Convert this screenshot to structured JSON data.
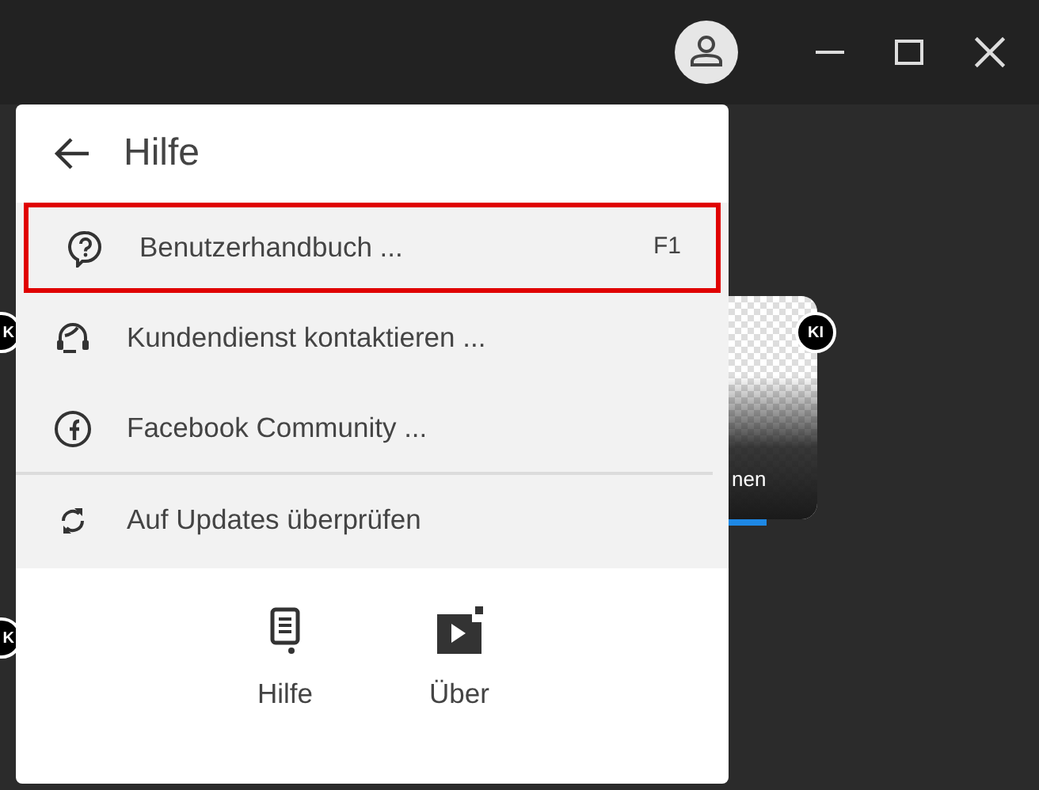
{
  "background_cards": [
    {
      "badge": "KI",
      "caption": "nen"
    }
  ],
  "left_badges": [
    "K",
    "K"
  ],
  "menu": {
    "title": "Hilfe",
    "items": [
      {
        "kind": "help",
        "label": "Benutzerhandbuch ...",
        "shortcut": "F1",
        "selected": true
      },
      {
        "kind": "headset",
        "label": "Kundendienst kontaktieren ...",
        "selected": false
      },
      {
        "kind": "facebook",
        "label": "Facebook Community ...",
        "selected": false
      },
      {
        "kind": "refresh",
        "label": "Auf Updates überprüfen",
        "selected": false,
        "divider_before": true
      }
    ],
    "bottom_buttons": [
      {
        "kind": "manual",
        "label": "Hilfe"
      },
      {
        "kind": "play",
        "label": "Über"
      }
    ]
  }
}
